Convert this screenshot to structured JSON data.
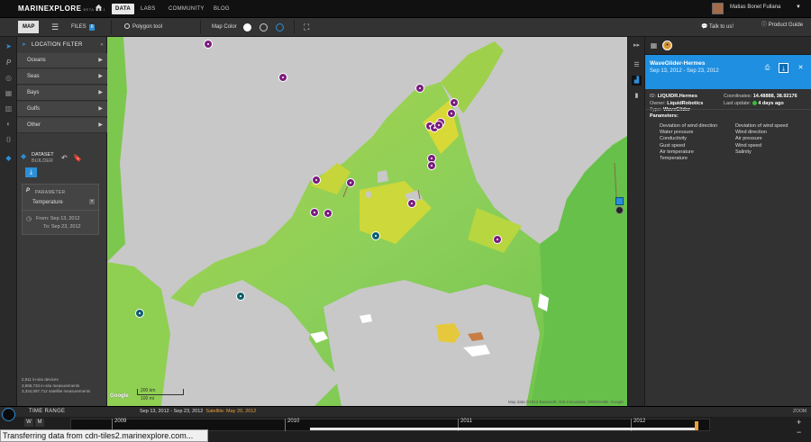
{
  "topnav": {
    "logo": "MARINEXPLORE",
    "logo_sub": "BETA 0.2.1",
    "items": [
      "DATA",
      "LABS",
      "COMMUNITY",
      "BLOG"
    ],
    "active": "DATA",
    "user_name": "Matias Bonet Fullana"
  },
  "toolbar": {
    "map_label": "MAP",
    "files_label": "FILES",
    "files_count": "6",
    "polygon_tool": "Polygon tool",
    "map_color_label": "Map Color",
    "talk_label": "Talk to us!",
    "product_guide_label": "Product Guide"
  },
  "location_filter": {
    "title": "LOCATION FILTER",
    "items": [
      "Oceans",
      "Seas",
      "Bays",
      "Gulfs",
      "Other"
    ]
  },
  "dataset_builder": {
    "title_line1": "DATASET",
    "title_line2": "BUILDER",
    "param_title": "PARAMETER",
    "param_value": "Temperature",
    "from_label": "From: Sep 13, 2012",
    "to_label": "To: Sep 23, 2012"
  },
  "stats": {
    "line1": "2,911 in-situ devices",
    "line2": "3,988,733 in-situ measurements",
    "line3": "3,334,097,712 satellite measurements"
  },
  "map": {
    "scale_km": "200 km",
    "scale_mi": "100 mi",
    "attribution": "Map data ©2013 Basarsoft, GIS Innovatsia, ORION-ME, Google",
    "google_logo": "Google"
  },
  "device": {
    "name": "WaveGlider-Hermes",
    "dates": "Sep 13, 2012 - Sep 23, 2012",
    "id_label": "ID:",
    "id_value": "LIQUIDR.Hermes",
    "owner_label": "Owner:",
    "owner_value": "LiquidRobotics",
    "type_label": "Type:",
    "type_value": "WaveGlider",
    "coord_label": "Coordinates:",
    "coord_value": "14.48888, 38.92176",
    "update_label": "Last update:",
    "update_value": "4 days ago",
    "params_title": "Parameters:",
    "params_left": [
      "Deviation of wind direction",
      "Water pressure",
      "Conductivity",
      "Gust speed",
      "Air temperature",
      "Temperature"
    ],
    "params_right": [
      "Deviation of wind speed",
      "Wind direction",
      "Air pressure",
      "Wind speed",
      "Salinity"
    ]
  },
  "timerange": {
    "label": "TIME RANGE",
    "range": "Sep 13, 2012 - Sep 23, 2012",
    "satellite": "Satellite: May 20, 2012",
    "years": [
      "2009",
      "2010",
      "2011",
      "2012"
    ],
    "btn_w": "W",
    "btn_m": "M",
    "zoom_label": "ZOOM"
  },
  "status_text": "Transferring data from cdn-tiles2.marinexplore.com..."
}
